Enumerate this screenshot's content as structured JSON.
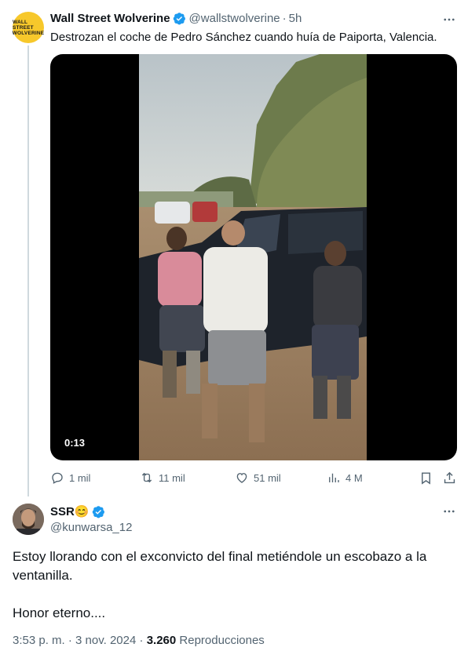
{
  "tweet": {
    "author_name": "Wall Street Wolverine",
    "avatar_text_1": "WALL STREET",
    "avatar_text_2": "WOLVERINE",
    "handle": "@wallstwolverine",
    "separator": "·",
    "time": "5h",
    "text": "Destrozan el coche de Pedro Sánchez cuando huía de Paiporta, Valencia.",
    "video_timecode": "0:13",
    "actions": {
      "replies": "1 mil",
      "reposts": "11 mil",
      "likes": "51 mil",
      "views": "4 M"
    }
  },
  "reply": {
    "author_name": "SSR😊",
    "handle": "@kunwarsa_12",
    "text_line1": "Estoy llorando con el exconvicto del final metiéndole un escobazo a la ventanilla.",
    "text_line2": "Honor eterno....",
    "time": "3:53 p. m.",
    "separator": "·",
    "date": "3 nov. 2024",
    "separator2": "·",
    "views_count": "3.260",
    "views_label": "Reproducciones"
  },
  "colors": {
    "text": "#0f1419",
    "secondary": "#536471",
    "verified": "#1d9bf0",
    "avatar_yellow": "#f7c82b"
  }
}
